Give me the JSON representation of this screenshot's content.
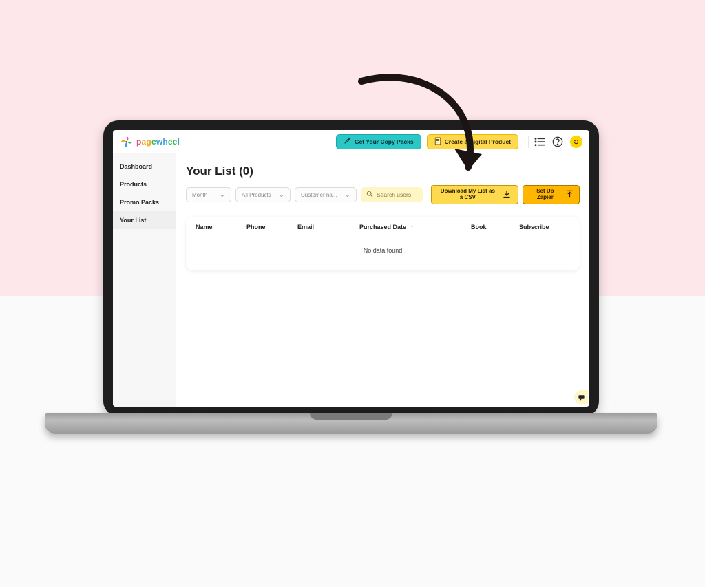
{
  "brand": {
    "name": "pagewheel"
  },
  "header": {
    "copy_packs_label": "Get Your Copy Packs",
    "create_product_label": "Create a Digital Product"
  },
  "sidebar": {
    "items": [
      {
        "label": "Dashboard"
      },
      {
        "label": "Products"
      },
      {
        "label": "Promo Packs"
      },
      {
        "label": "Your List"
      }
    ]
  },
  "page": {
    "title": "Your List (0)"
  },
  "filters": {
    "month_label": "Month",
    "products_label": "All Products",
    "customer_label": "Customer na...",
    "search_placeholder": "Search users"
  },
  "actions": {
    "download_label": "Download My List as a CSV",
    "zapier_label": "Set Up Zapier"
  },
  "table": {
    "columns": {
      "name": "Name",
      "phone": "Phone",
      "email": "Email",
      "purchased": "Purchased Date",
      "book": "Book",
      "subscribe": "Subscribe"
    },
    "empty_text": "No data found"
  }
}
